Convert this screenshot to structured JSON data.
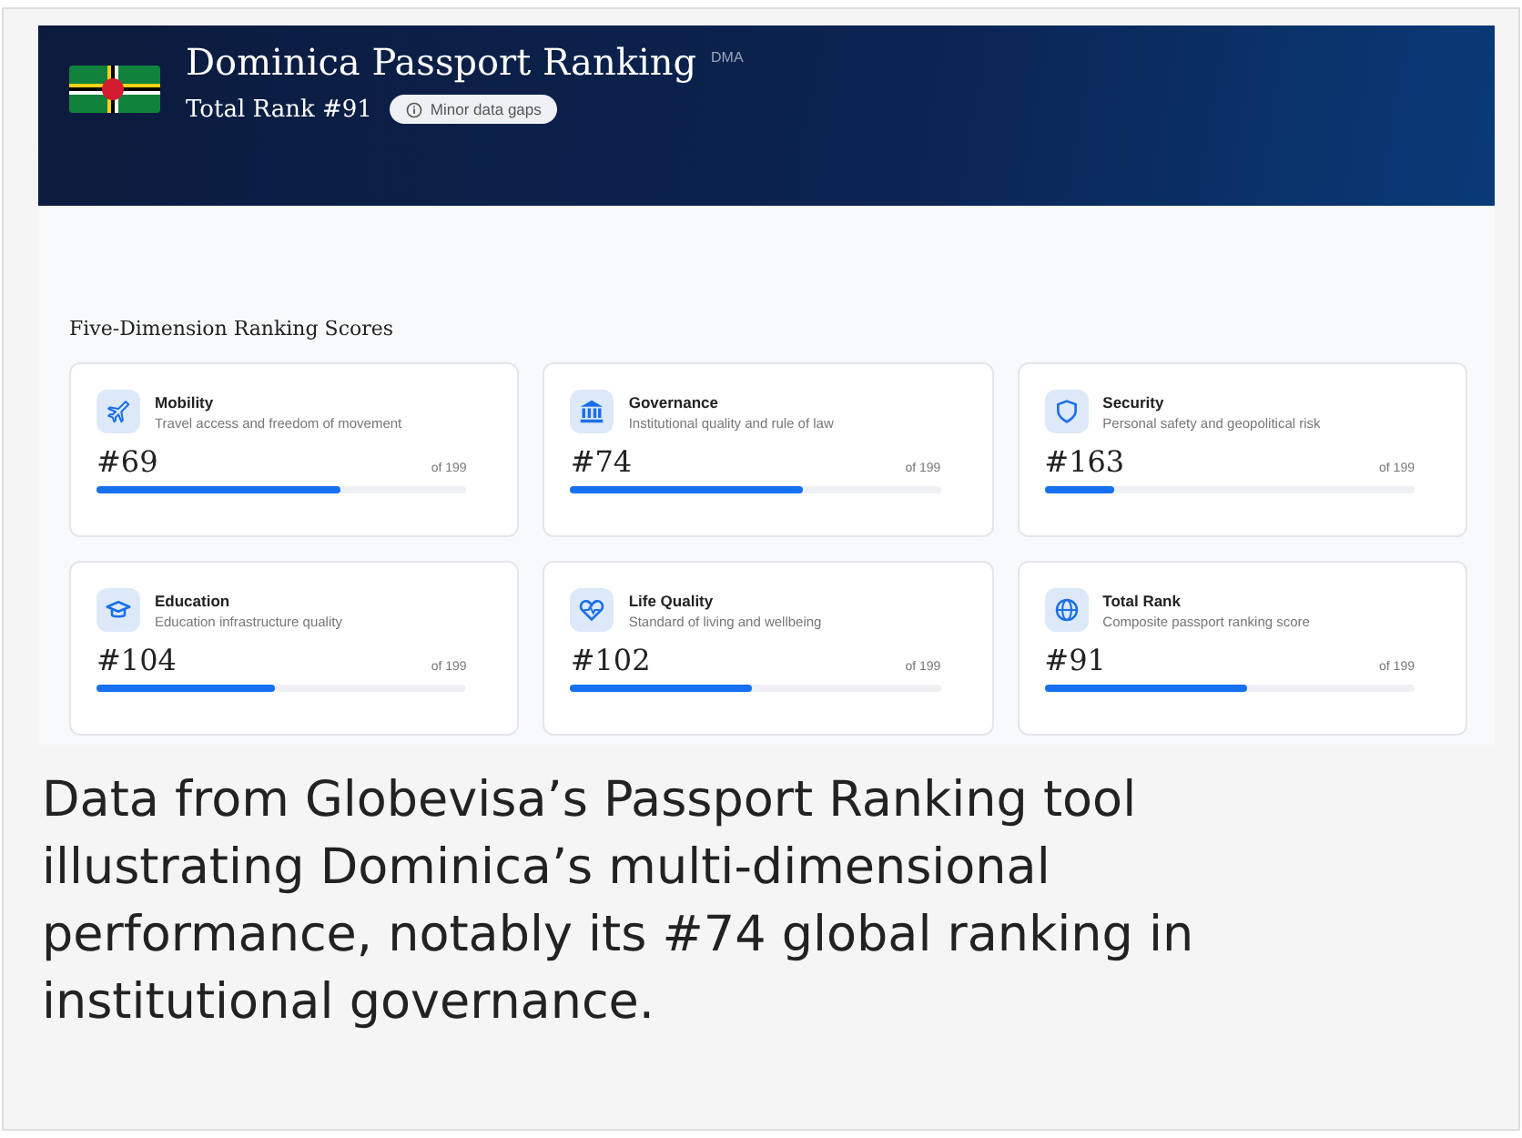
{
  "header": {
    "title": "Dominica Passport Ranking",
    "code": "DMA",
    "total_rank": "Total Rank #91",
    "badge": "Minor data gaps"
  },
  "section_title": "Five-Dimension Ranking Scores",
  "cards": [
    {
      "kind": "plane",
      "title": "Mobility",
      "subtitle": "Travel access and freedom of movement",
      "rank": "#69",
      "of": "of 199",
      "level": 0.66
    },
    {
      "kind": "bank",
      "title": "Governance",
      "subtitle": "Institutional quality and rule of law",
      "rank": "#74",
      "of": "of 199",
      "level": 0.63
    },
    {
      "kind": "shield",
      "title": "Security",
      "subtitle": "Personal safety and geopolitical risk",
      "rank": "#163",
      "of": "of 199",
      "level": 0.19
    },
    {
      "kind": "cap",
      "title": "Education",
      "subtitle": "Education infrastructure quality",
      "rank": "#104",
      "of": "of 199",
      "level": 0.48
    },
    {
      "kind": "heart",
      "title": "Life Quality",
      "subtitle": "Standard of living and wellbeing",
      "rank": "#102",
      "of": "of 199",
      "level": 0.49
    },
    {
      "kind": "globe",
      "title": "Total Rank",
      "subtitle": "Composite passport ranking score",
      "rank": "#91",
      "of": "of 199",
      "level": 0.55
    }
  ],
  "caption": "Data from Globevisa’s Passport Ranking tool illustrating Dominica’s multi-dimensional performance, notably its #74 global ranking in institutional governance."
}
